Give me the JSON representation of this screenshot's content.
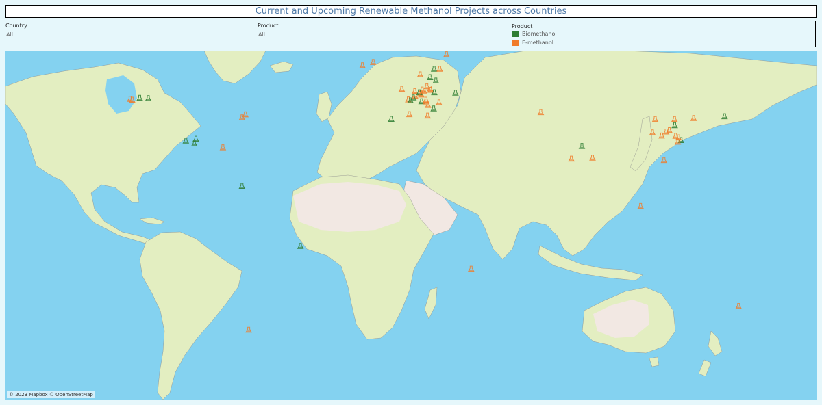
{
  "title": "Current and Upcoming Renewable Methanol Projects across Countries",
  "filters": [
    {
      "label": "Country",
      "value": "All"
    },
    {
      "label": "Product",
      "value": "All"
    }
  ],
  "legend": {
    "title": "Product",
    "items": [
      {
        "label": "Biomethanol",
        "color": "#2e7d32"
      },
      {
        "label": "E-methanol",
        "color": "#f07c2a"
      }
    ]
  },
  "map": {
    "attribution": "© 2023 Mapbox © OpenStreetMap",
    "colors": {
      "ocean": "#84d2f0",
      "land": "#e3eec1",
      "desert": "#f2e8e3",
      "border": "#8a8a8a"
    },
    "marker_icon": "flask-icon",
    "projects": [
      {
        "product": "Biomethanol",
        "lon": -119.5,
        "lat": 49.9
      },
      {
        "product": "Biomethanol",
        "lon": -115.7,
        "lat": 49.8
      },
      {
        "product": "E-methanol",
        "lon": -123.8,
        "lat": 49.5
      },
      {
        "product": "E-methanol",
        "lon": -122.9,
        "lat": 49.1
      },
      {
        "product": "E-methanol",
        "lon": -72.5,
        "lat": 42.6
      },
      {
        "product": "E-methanol",
        "lon": -74.0,
        "lat": 41.3
      },
      {
        "product": "Biomethanol",
        "lon": -99.0,
        "lat": 31.0
      },
      {
        "product": "Biomethanol",
        "lon": -94.5,
        "lat": 31.8
      },
      {
        "product": "Biomethanol",
        "lon": -95.2,
        "lat": 29.7
      },
      {
        "product": "E-methanol",
        "lon": -82.5,
        "lat": 28.0
      },
      {
        "product": "Biomethanol",
        "lon": -74.0,
        "lat": 10.9
      },
      {
        "product": "Biomethanol",
        "lon": -48.0,
        "lat": -15.7
      },
      {
        "product": "E-methanol",
        "lon": -71.0,
        "lat": -52.8
      },
      {
        "product": "E-methanol",
        "lon": -20.4,
        "lat": 64.3
      },
      {
        "product": "E-methanol",
        "lon": -15.6,
        "lat": 65.8
      },
      {
        "product": "E-methanol",
        "lon": 17.0,
        "lat": 69.2
      },
      {
        "product": "Biomethanol",
        "lon": 11.5,
        "lat": 62.8
      },
      {
        "product": "E-methanol",
        "lon": 5.3,
        "lat": 60.3
      },
      {
        "product": "E-methanol",
        "lon": 14.0,
        "lat": 62.8
      },
      {
        "product": "Biomethanol",
        "lon": 9.7,
        "lat": 59.1
      },
      {
        "product": "Biomethanol",
        "lon": 12.3,
        "lat": 57.6
      },
      {
        "product": "E-methanol",
        "lon": -2.9,
        "lat": 53.9
      },
      {
        "product": "E-methanol",
        "lon": 2.9,
        "lat": 52.9
      },
      {
        "product": "E-methanol",
        "lon": 6.2,
        "lat": 53.6
      },
      {
        "product": "E-methanol",
        "lon": 8.3,
        "lat": 55.1
      },
      {
        "product": "E-methanol",
        "lon": 9.7,
        "lat": 54.1
      },
      {
        "product": "E-methanol",
        "lon": 7.0,
        "lat": 53.1
      },
      {
        "product": "E-methanol",
        "lon": 10.0,
        "lat": 53.5
      },
      {
        "product": "E-methanol",
        "lon": 5.4,
        "lat": 52.2
      },
      {
        "product": "Biomethanol",
        "lon": 4.9,
        "lat": 52.4
      },
      {
        "product": "Biomethanol",
        "lon": 11.6,
        "lat": 52.4
      },
      {
        "product": "Biomethanol",
        "lon": 21.0,
        "lat": 52.2
      },
      {
        "product": "E-methanol",
        "lon": 5.8,
        "lat": 51.4
      },
      {
        "product": "E-methanol",
        "lon": 3.0,
        "lat": 50.9
      },
      {
        "product": "Biomethanol",
        "lon": 2.3,
        "lat": 50.1
      },
      {
        "product": "E-methanol",
        "lon": 0.0,
        "lat": 49.2
      },
      {
        "product": "Biomethanol",
        "lon": 1.0,
        "lat": 48.8
      },
      {
        "product": "Biomethanol",
        "lon": 5.9,
        "lat": 48.4
      },
      {
        "product": "E-methanol",
        "lon": 7.9,
        "lat": 49.1
      },
      {
        "product": "E-methanol",
        "lon": 8.0,
        "lat": 48.3
      },
      {
        "product": "E-methanol",
        "lon": 8.8,
        "lat": 46.8
      },
      {
        "product": "E-methanol",
        "lon": 13.7,
        "lat": 47.9
      },
      {
        "product": "Biomethanol",
        "lon": 11.3,
        "lat": 45.2
      },
      {
        "product": "E-methanol",
        "lon": 0.5,
        "lat": 42.7
      },
      {
        "product": "Biomethanol",
        "lon": -7.6,
        "lat": 40.6
      },
      {
        "product": "E-methanol",
        "lon": 8.6,
        "lat": 42.1
      },
      {
        "product": "E-methanol",
        "lon": 59.0,
        "lat": 43.6
      },
      {
        "product": "E-methanol",
        "lon": 109.9,
        "lat": 40.5
      },
      {
        "product": "E-methanol",
        "lon": 118.5,
        "lat": 40.5
      },
      {
        "product": "E-methanol",
        "lon": 127.0,
        "lat": 41.0
      },
      {
        "product": "Biomethanol",
        "lon": 140.8,
        "lat": 41.8
      },
      {
        "product": "Biomethanol",
        "lon": 118.6,
        "lat": 37.8
      },
      {
        "product": "E-methanol",
        "lon": 108.7,
        "lat": 34.6
      },
      {
        "product": "E-methanol",
        "lon": 114.8,
        "lat": 35.0
      },
      {
        "product": "E-methanol",
        "lon": 116.2,
        "lat": 35.6
      },
      {
        "product": "E-methanol",
        "lon": 112.8,
        "lat": 33.2
      },
      {
        "product": "E-methanol",
        "lon": 119.0,
        "lat": 33.1
      },
      {
        "product": "E-methanol",
        "lon": 120.3,
        "lat": 32.4
      },
      {
        "product": "Biomethanol",
        "lon": 121.4,
        "lat": 31.2
      },
      {
        "product": "E-methanol",
        "lon": 120.0,
        "lat": 30.5
      },
      {
        "product": "Biomethanol",
        "lon": 77.3,
        "lat": 28.6
      },
      {
        "product": "E-methanol",
        "lon": 72.6,
        "lat": 23.0
      },
      {
        "product": "E-methanol",
        "lon": 82.0,
        "lat": 23.4
      },
      {
        "product": "E-methanol",
        "lon": 113.8,
        "lat": 22.4
      },
      {
        "product": "E-methanol",
        "lon": 103.4,
        "lat": 2.0
      },
      {
        "product": "E-methanol",
        "lon": 28.0,
        "lat": -25.8
      },
      {
        "product": "E-methanol",
        "lon": 147.0,
        "lat": -42.3
      }
    ]
  }
}
